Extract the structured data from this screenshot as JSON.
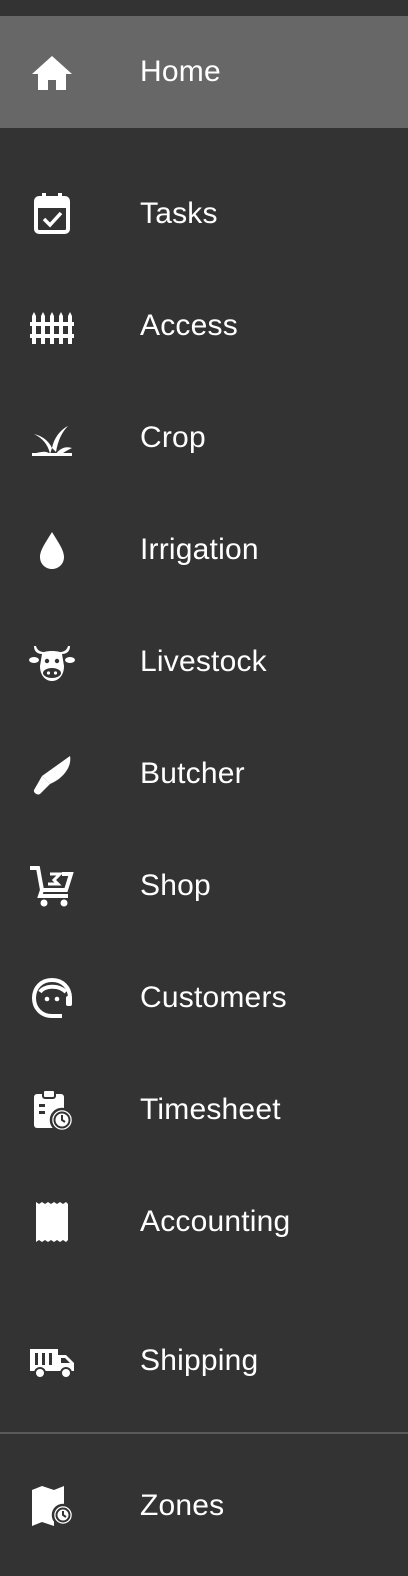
{
  "nav": {
    "items": [
      {
        "label": "Home",
        "icon": "home-icon",
        "active": true
      },
      {
        "label": "Tasks",
        "icon": "calendar-check-icon"
      },
      {
        "label": "Access",
        "icon": "fence-icon"
      },
      {
        "label": "Crop",
        "icon": "sprout-icon"
      },
      {
        "label": "Irrigation",
        "icon": "water-drop-icon"
      },
      {
        "label": "Livestock",
        "icon": "cow-icon"
      },
      {
        "label": "Butcher",
        "icon": "knife-icon"
      },
      {
        "label": "Shop",
        "icon": "cart-icon"
      },
      {
        "label": "Customers",
        "icon": "face-agent-icon"
      },
      {
        "label": "Timesheet",
        "icon": "clipboard-clock-icon"
      },
      {
        "label": "Accounting",
        "icon": "receipt-icon"
      },
      {
        "label": "Shipping",
        "icon": "truck-icon"
      },
      {
        "label": "Zones",
        "icon": "map-clock-icon"
      }
    ]
  },
  "colors": {
    "background": "#333333",
    "active_background": "#676767",
    "text": "#ffffff",
    "divider": "#5a5a5a"
  }
}
